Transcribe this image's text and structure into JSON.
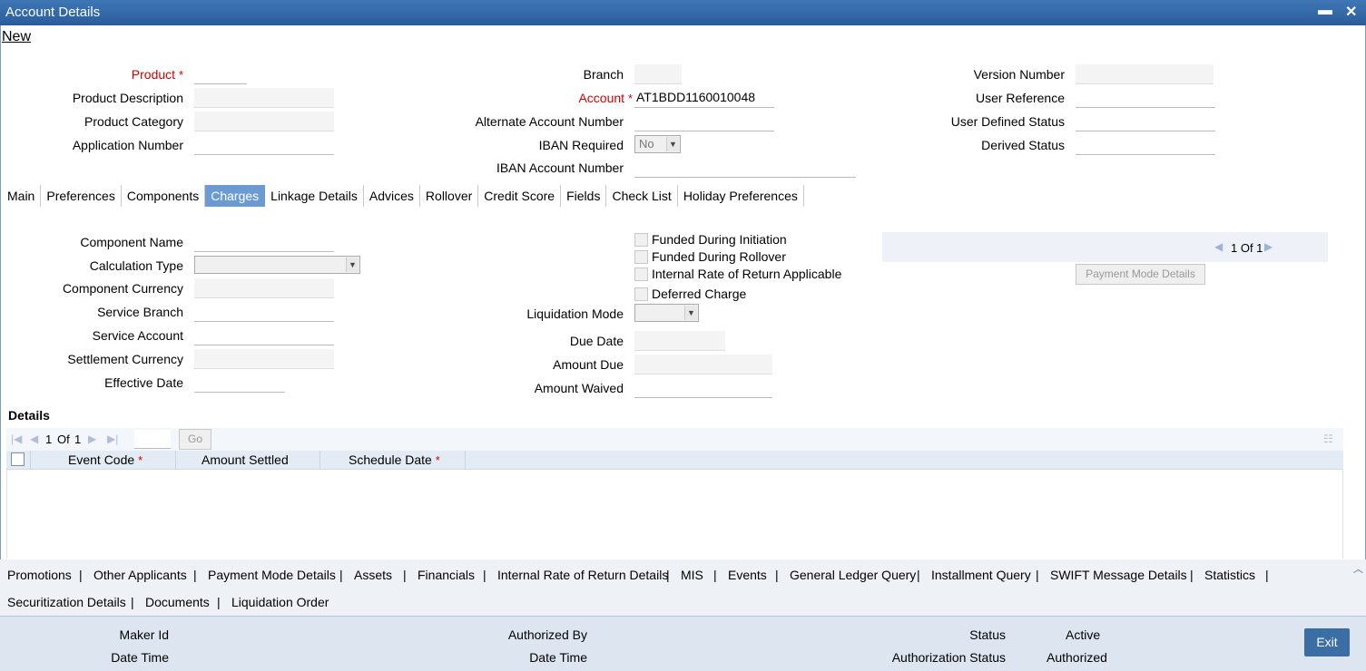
{
  "window": {
    "title": "Account Details",
    "minimize": "▬",
    "close": "✕"
  },
  "toolbar": {
    "new_label": "New"
  },
  "header": {
    "product": {
      "label": "Product",
      "value": ""
    },
    "product_description": {
      "label": "Product Description",
      "value": ""
    },
    "product_category": {
      "label": "Product Category",
      "value": ""
    },
    "application_number": {
      "label": "Application Number",
      "value": ""
    },
    "branch": {
      "label": "Branch",
      "value": ""
    },
    "account": {
      "label": "Account",
      "value": "AT1BDD1160010048"
    },
    "alternate_account_number": {
      "label": "Alternate Account Number",
      "value": ""
    },
    "iban_required": {
      "label": "IBAN Required",
      "value": "No"
    },
    "iban_account_number": {
      "label": "IBAN Account Number",
      "value": ""
    },
    "version_number": {
      "label": "Version Number",
      "value": ""
    },
    "user_reference": {
      "label": "User Reference",
      "value": ""
    },
    "user_defined_status": {
      "label": "User Defined Status",
      "value": ""
    },
    "derived_status": {
      "label": "Derived Status",
      "value": ""
    }
  },
  "tabs": [
    {
      "label": "Main",
      "active": false
    },
    {
      "label": "Preferences",
      "active": false
    },
    {
      "label": "Components",
      "active": false
    },
    {
      "label": "Charges",
      "active": true
    },
    {
      "label": "Linkage Details",
      "active": false
    },
    {
      "label": "Advices",
      "active": false
    },
    {
      "label": "Rollover",
      "active": false
    },
    {
      "label": "Credit Score",
      "active": false
    },
    {
      "label": "Fields",
      "active": false
    },
    {
      "label": "Check List",
      "active": false
    },
    {
      "label": "Holiday Preferences",
      "active": false
    }
  ],
  "charges": {
    "component_name": {
      "label": "Component Name",
      "value": ""
    },
    "calculation_type": {
      "label": "Calculation Type",
      "value": ""
    },
    "component_currency": {
      "label": "Component Currency",
      "value": ""
    },
    "service_branch": {
      "label": "Service Branch",
      "value": ""
    },
    "service_account": {
      "label": "Service Account",
      "value": ""
    },
    "settlement_currency": {
      "label": "Settlement Currency",
      "value": ""
    },
    "effective_date": {
      "label": "Effective Date",
      "value": ""
    },
    "funded_during_initiation": {
      "label": "Funded During Initiation",
      "checked": false
    },
    "funded_during_rollover": {
      "label": "Funded During Rollover",
      "checked": false
    },
    "irr_applicable": {
      "label": "Internal Rate of Return Applicable",
      "checked": false
    },
    "deferred_charge": {
      "label": "Deferred Charge",
      "checked": false
    },
    "liquidation_mode": {
      "label": "Liquidation Mode",
      "value": ""
    },
    "due_date": {
      "label": "Due Date",
      "value": ""
    },
    "amount_due": {
      "label": "Amount Due",
      "value": ""
    },
    "amount_waived": {
      "label": "Amount Waived",
      "value": ""
    },
    "pager": {
      "text": "1 Of 1"
    },
    "payment_mode_button": "Payment Mode Details"
  },
  "details": {
    "title": "Details",
    "pager": {
      "current": "1",
      "of": "Of",
      "total": "1",
      "go": "Go"
    },
    "columns": [
      "Event Code",
      "Amount Settled",
      "Schedule Date"
    ],
    "rows": []
  },
  "sub_links": [
    "Promotions",
    "Other Applicants",
    "Payment Mode Details",
    "Assets",
    "Financials",
    "Internal Rate of Return Details",
    "MIS",
    "Events",
    "General Ledger Query",
    "Installment Query",
    "SWIFT Message Details",
    "Statistics",
    "Securitization Details",
    "Documents",
    "Liquidation Order"
  ],
  "footer": {
    "maker_id": "Maker Id",
    "date_time_1": "Date Time",
    "authorized_by": "Authorized By",
    "date_time_2": "Date Time",
    "status_label": "Status",
    "status_value": "Active",
    "auth_status_label": "Authorization Status",
    "auth_status_value": "Authorized",
    "exit": "Exit"
  },
  "colors": {
    "titlebar": "#2a5c9a",
    "active_tab": "#6b9bd2",
    "required": "#d40000",
    "exit_button": "#3a6ea5"
  }
}
